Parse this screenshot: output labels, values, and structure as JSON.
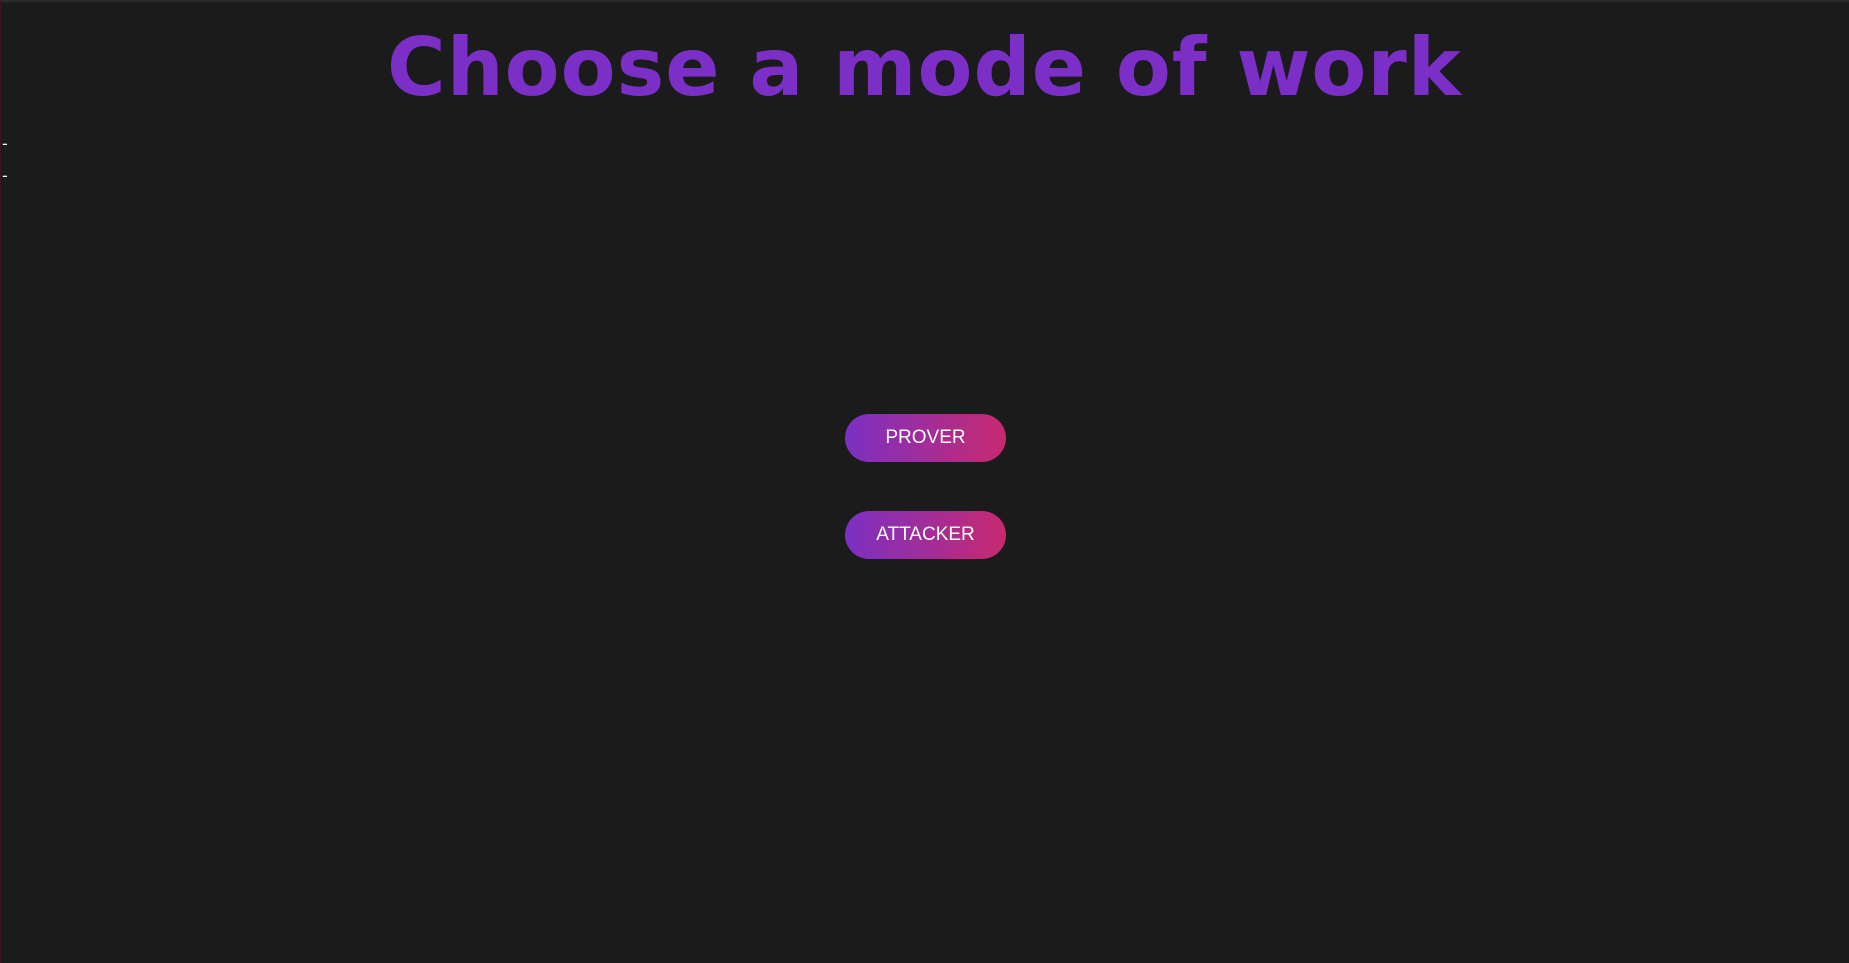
{
  "page": {
    "title": "Choose a mode of work",
    "side_items": [
      "-",
      "-"
    ]
  },
  "buttons": {
    "prover_label": "PROVER",
    "attacker_label": "ATTACKER"
  },
  "colors": {
    "background": "#1b1b1b",
    "title": "#7b2fc6",
    "button_gradient_start": "#7b30c4",
    "button_gradient_end": "#c72a6e",
    "button_text": "#ffffff"
  }
}
